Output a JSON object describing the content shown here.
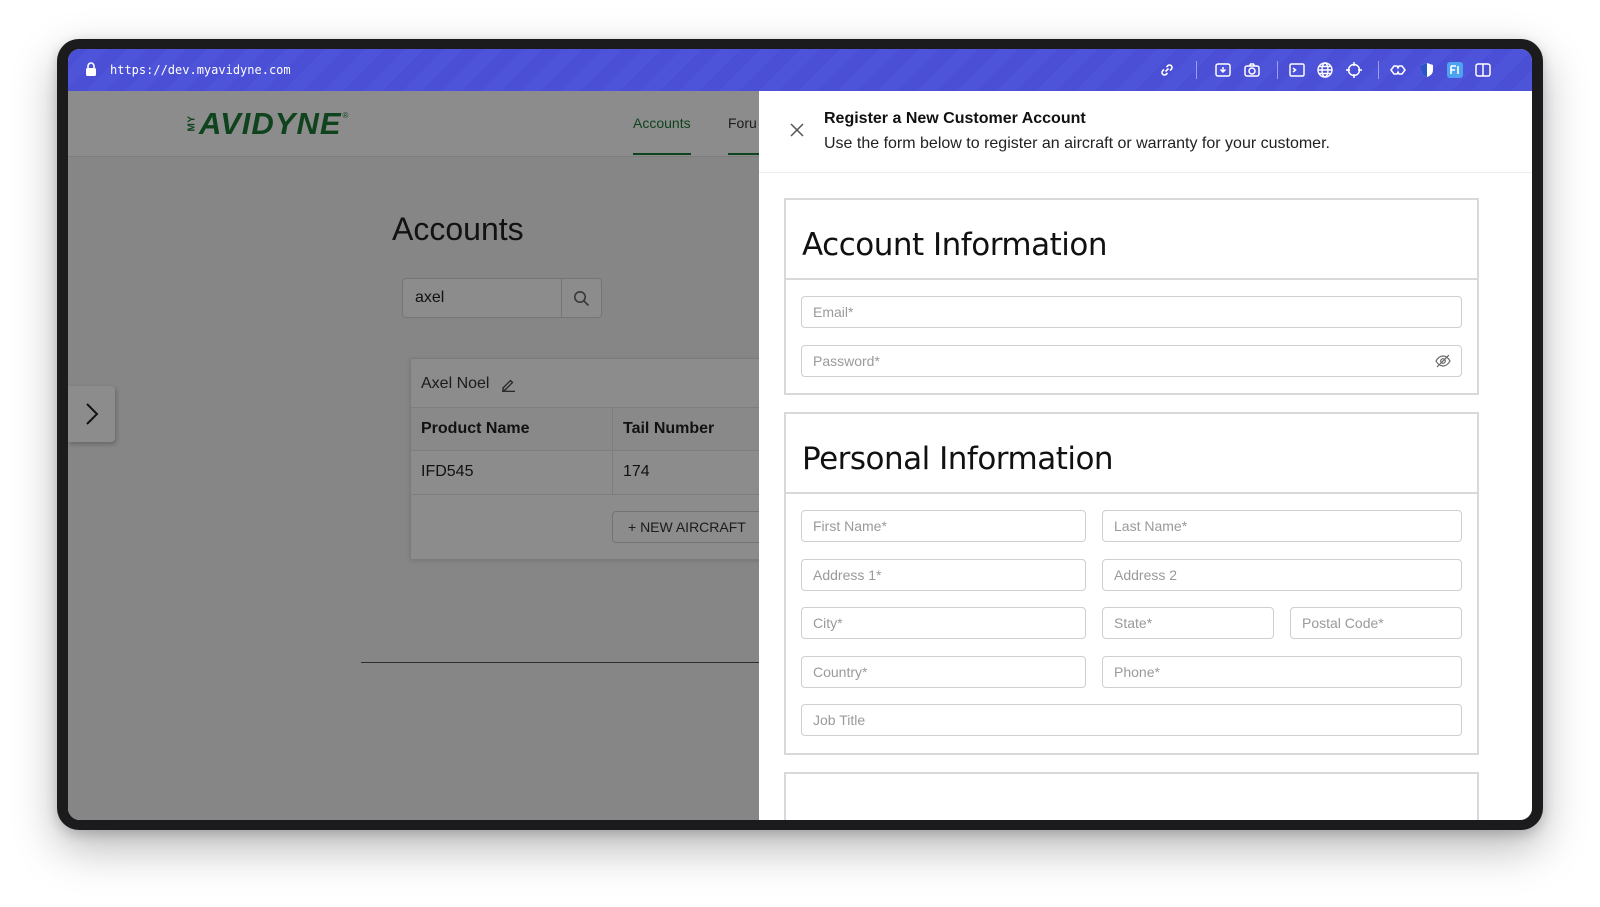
{
  "browser": {
    "url": "https://dev.myavidyne.com",
    "toolbar_icons": [
      "link-icon",
      "download-icon",
      "camera-icon",
      "terminal-icon",
      "globe-icon",
      "crosshair-icon",
      "puzzle-icon",
      "shield-icon",
      "extension-badge-icon",
      "sidebar-icon"
    ]
  },
  "header": {
    "logo_prefix": "MY",
    "logo_text": "AVIDYNE",
    "logo_mark": "®",
    "nav": [
      {
        "label": "Accounts",
        "active": true
      },
      {
        "label": "Foru",
        "active": false
      }
    ]
  },
  "accounts": {
    "title": "Accounts",
    "search_value": "axel",
    "card": {
      "name": "Axel Noel",
      "columns": [
        "Product Name",
        "Tail Number"
      ],
      "rows": [
        [
          "IFD545",
          "174"
        ]
      ],
      "new_aircraft_label": "+ NEW AIRCRAFT"
    }
  },
  "drawer": {
    "title": "Register a New Customer Account",
    "subtitle": "Use the form below to register an aircraft or warranty for your customer.",
    "sections": {
      "account": {
        "title": "Account Information",
        "email_placeholder": "Email*",
        "password_placeholder": "Password*"
      },
      "personal": {
        "title": "Personal Information",
        "first_name_placeholder": "First Name*",
        "last_name_placeholder": "Last Name*",
        "address1_placeholder": "Address 1*",
        "address2_placeholder": "Address 2",
        "city_placeholder": "City*",
        "state_placeholder": "State*",
        "postal_placeholder": "Postal Code*",
        "country_placeholder": "Country*",
        "phone_placeholder": "Phone*",
        "job_title_placeholder": "Job Title"
      }
    }
  },
  "colors": {
    "brand_green": "#1d7a35",
    "browser_bar": "#4a4fd6"
  }
}
